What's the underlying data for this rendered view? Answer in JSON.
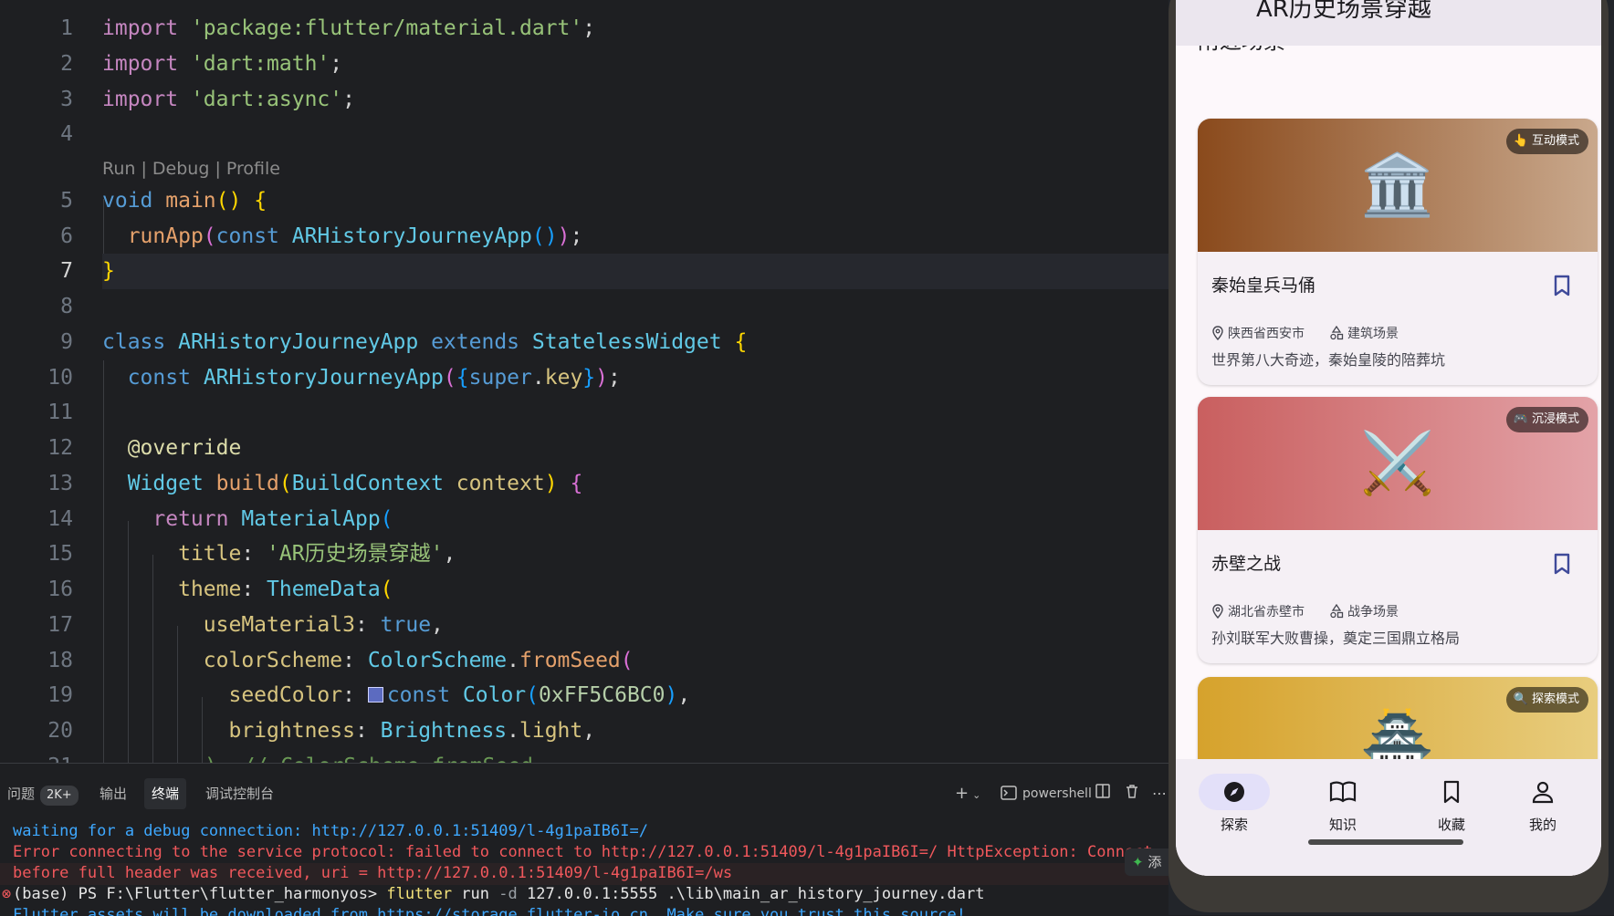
{
  "editor": {
    "codelens": [
      "Run",
      "Debug",
      "Profile"
    ],
    "lines": [
      {
        "n": "1"
      },
      {
        "n": "2"
      },
      {
        "n": "3"
      },
      {
        "n": "4"
      },
      {
        "n": "5"
      },
      {
        "n": "6"
      },
      {
        "n": "7"
      },
      {
        "n": "8"
      },
      {
        "n": "9"
      },
      {
        "n": "10"
      },
      {
        "n": "11"
      },
      {
        "n": "12"
      },
      {
        "n": "13"
      },
      {
        "n": "14"
      },
      {
        "n": "15"
      },
      {
        "n": "16"
      },
      {
        "n": "17"
      },
      {
        "n": "18"
      },
      {
        "n": "19"
      },
      {
        "n": "20"
      },
      {
        "n": "21"
      }
    ],
    "active_line": "7",
    "swatch_color": "#5C6BC0",
    "tokens": {
      "import": "import",
      "material": "'package:flutter/material.dart'",
      "math": "'dart:math'",
      "async": "'dart:async'",
      "void": "void",
      "main": "main",
      "runApp": "runApp",
      "const": "const",
      "appClass": "ARHistoryJourneyApp",
      "class": "class",
      "extends": "extends",
      "stateless": "StatelessWidget",
      "super": "super",
      "key": "key",
      "override": "@override",
      "widget": "Widget",
      "build": "build",
      "buildContext": "BuildContext",
      "context": "context",
      "return": "return",
      "materialApp": "MaterialApp",
      "title": "title",
      "titleValue": "'AR历史场景穿越'",
      "theme": "theme",
      "themeData": "ThemeData",
      "useMaterial3": "useMaterial3",
      "true": "true",
      "colorScheme": "colorScheme",
      "colorSchemeClass": "ColorScheme",
      "fromSeed": "fromSeed",
      "seedColor": "seedColor",
      "color": "Color",
      "colorValue": "0xFF5C6BC0",
      "brightness": "brightness",
      "brightnessClass": "Brightness",
      "light": "light",
      "line21": "), // ColorScheme.fromSeed"
    }
  },
  "panel": {
    "tabs": {
      "problems": "问题",
      "problems_count": "2K+",
      "output": "输出",
      "terminal": "终端",
      "debug_console": "调试控制台"
    },
    "tools": {
      "add": "+",
      "shell": "powershell"
    },
    "terminal_lines": {
      "l1": "waiting for a debug connection: http://127.0.0.1:51409/l-4g1paIB6I=/",
      "l2": "Error connecting to the service protocol: failed to connect to http://127.0.0.1:51409/l-4g1paIB6I=/ HttpException: Connect",
      "l3": "before full header was received, uri = http://127.0.0.1:51409/l-4g1paIB6I=/ws",
      "l4_prefix": "(base) PS F:\\Flutter\\flutter_harmonyos> ",
      "l4_cmd": "flutter",
      "l4_rest": " run ",
      "l4_flag": "-d",
      "l4_args": " 127.0.0.1:5555 .\\lib\\main_ar_history_journey.dart",
      "l5": "Flutter assets will be downloaded from https://storage.flutter-io.cn. Make sure you trust this source!"
    },
    "chip": "添"
  },
  "phone": {
    "app_title": "AR历史场景穿越",
    "section_title": "附近场景",
    "cards": [
      {
        "name": "秦始皇兵马俑",
        "location": "陕西省西安市",
        "category": "建筑场景",
        "description": "世界第八大奇迹，秦始皇陵的陪葬坑",
        "mode": "互动模式",
        "mode_emoji": "👆",
        "emoji": "🏛️",
        "gradient": [
          "#8a4a1c",
          "#c9a88c"
        ]
      },
      {
        "name": "赤壁之战",
        "location": "湖北省赤壁市",
        "category": "战争场景",
        "description": "孙刘联军大败曹操，奠定三国鼎立格局",
        "mode": "沉浸模式",
        "mode_emoji": "🎮",
        "emoji": "⚔️",
        "gradient": [
          "#c95f5f",
          "#e3a3a8"
        ]
      },
      {
        "name": "",
        "location": "",
        "category": "",
        "description": "",
        "mode": "探索模式",
        "mode_emoji": "🔍",
        "emoji": "🏯",
        "gradient": [
          "#d6a22c",
          "#e8cd7e"
        ]
      }
    ],
    "nav": {
      "explore": "探索",
      "knowledge": "知识",
      "favorites": "收藏",
      "me": "我的"
    }
  }
}
